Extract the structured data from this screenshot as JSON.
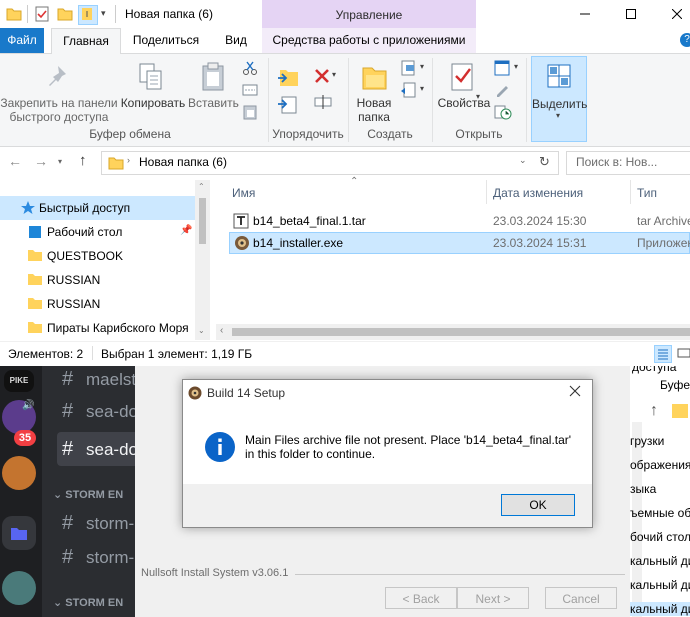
{
  "explorer": {
    "title": "Новая папка (6)",
    "context_band_label": "Управление",
    "tabs": {
      "file": "Файл",
      "home": "Главная",
      "share": "Поделиться",
      "view": "Вид",
      "app_tools": "Средства работы с приложениями"
    },
    "ribbon": {
      "pin_label": "Закрепить на панели быстрого доступа",
      "copy_label": "Копировать",
      "paste_label": "Вставить",
      "new_folder_label": "Новая папка",
      "properties_label": "Свойства",
      "select_label": "Выделить",
      "groups": {
        "clipboard": "Буфер обмена",
        "organize": "Упорядочить",
        "create": "Создать",
        "open": "Открыть"
      }
    },
    "address": {
      "path": "Новая папка (6)",
      "search_placeholder": "Поиск в: Нов..."
    },
    "nav": {
      "items": [
        {
          "label": "Быстрый доступ"
        },
        {
          "label": "Рабочий стол"
        },
        {
          "label": "QUESTBOOK"
        },
        {
          "label": "RUSSIAN"
        },
        {
          "label": "RUSSIAN"
        },
        {
          "label": "Пираты Карибского Моря"
        }
      ]
    },
    "columns": {
      "name": "Имя",
      "date": "Дата изменения",
      "type": "Тип"
    },
    "files": [
      {
        "name": "b14_beta4_final.1.tar",
        "date": "23.03.2024 15:30",
        "type": "tar Archive"
      },
      {
        "name": "b14_installer.exe",
        "date": "23.03.2024 15:31",
        "type": "Приложение"
      }
    ],
    "status": {
      "count": "Элементов: 2",
      "selection": "Выбран 1 элемент: 1,19 ГБ"
    }
  },
  "discord": {
    "channels": [
      {
        "name": "maelst"
      },
      {
        "name": "sea-do"
      },
      {
        "name": "sea-do"
      },
      {
        "name": "storm-"
      },
      {
        "name": "storm-"
      }
    ],
    "categories": [
      "STORM EN",
      "STORM EN"
    ],
    "badge": "35",
    "server_tag": "PIKE"
  },
  "installer": {
    "branding": "Nullsoft Install System v3.06.1",
    "back_label": "< Back",
    "next_label": "Next >",
    "cancel_label": "Cancel"
  },
  "right_window": {
    "tab_label": "Буфер",
    "header_label": "доступа",
    "items": [
      "грузки",
      "ображения",
      "зыка",
      "ъемные об",
      "бочий стол",
      "кальный ди",
      "кальный ди",
      "кальный ди"
    ]
  },
  "dialog": {
    "title": "Build 14 Setup",
    "message": "Main Files archive file not present. Place 'b14_beta4_final.tar' in this folder to continue.",
    "ok_label": "OK"
  },
  "colors": {
    "file_tab": "#1979ca",
    "selection": "#cce8ff",
    "context_band": "#e5d4f4",
    "discord_bg": "#2b2d31",
    "info_icon": "#0a64c8"
  }
}
